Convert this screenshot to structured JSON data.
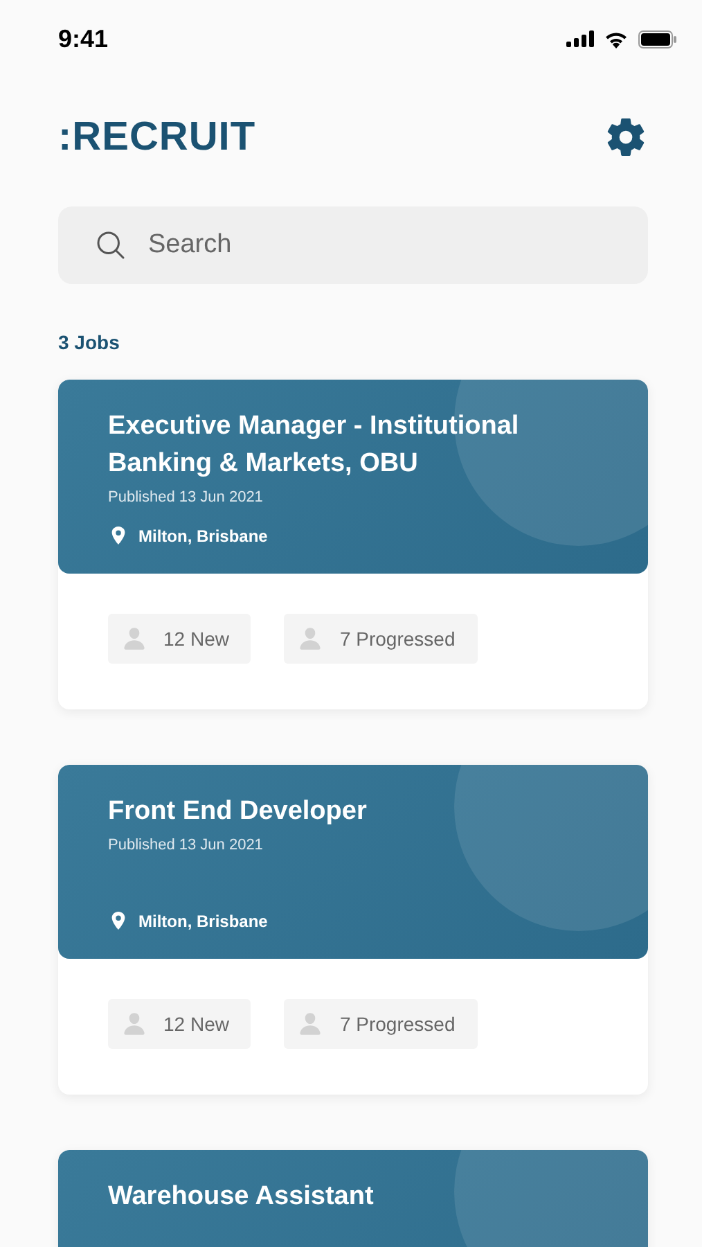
{
  "status_bar": {
    "time": "9:41"
  },
  "header": {
    "logo": ":RECRUIT"
  },
  "search": {
    "placeholder": "Search"
  },
  "job_count": "3 Jobs",
  "jobs": [
    {
      "title": "Executive Manager - Institutional Banking & Markets, OBU",
      "published": "Published 13 Jun 2021",
      "location": "Milton, Brisbane",
      "stats": [
        "12 New",
        "7 Progressed"
      ]
    },
    {
      "title": "Front End Developer",
      "published": "Published 13 Jun 2021",
      "location": "Milton, Brisbane",
      "stats": [
        "12 New",
        "7 Progressed"
      ]
    },
    {
      "title": "Warehouse Assistant"
    }
  ]
}
